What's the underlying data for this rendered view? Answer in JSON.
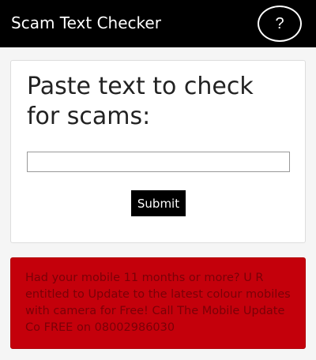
{
  "header": {
    "title": "Scam Text Checker",
    "help_label": "?",
    "background": "#000000"
  },
  "form": {
    "heading": "Paste text to check for scams:",
    "input_value": "",
    "input_placeholder": "",
    "submit_label": "Submit"
  },
  "result": {
    "message": "Had your mobile 11 months or more? U R entitled to Update to the latest colour mobiles with camera for Free! Call The Mobile Update Co FREE on 08002986030",
    "background": "#c4000b"
  }
}
